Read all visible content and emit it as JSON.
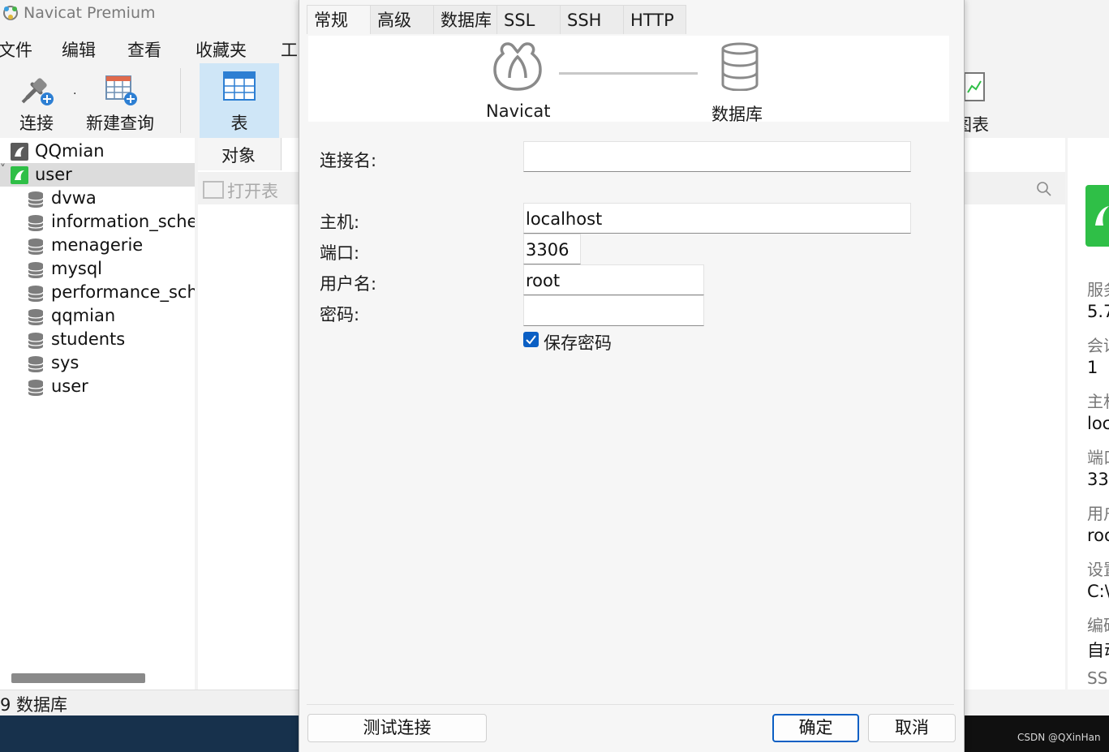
{
  "app": {
    "title": "Navicat Premium"
  },
  "menu": {
    "items": [
      "文件",
      "编辑",
      "查看",
      "收藏夹",
      "工"
    ]
  },
  "toolbar": {
    "connect_label": "连接",
    "new_query_label": "新建查询",
    "table_label": "表",
    "chart_label": "图表"
  },
  "tree": {
    "connections": [
      {
        "label": "QQmian"
      },
      {
        "label": "user"
      }
    ],
    "databases": [
      "dvwa",
      "information_sche",
      "menagerie",
      "mysql",
      "performance_sch",
      "qqmian",
      "students",
      "sys",
      "user"
    ]
  },
  "objects": {
    "tab_label": "对象",
    "open_table_label": "打开表"
  },
  "status": {
    "text": "9 数据库"
  },
  "right_panel": {
    "rows": [
      {
        "label": "服务",
        "value": "5.7"
      },
      {
        "label": "会话",
        "value": "1"
      },
      {
        "label": "主机",
        "value": "loc"
      },
      {
        "label": "端口",
        "value": "33"
      },
      {
        "label": "用户",
        "value": "roo"
      },
      {
        "label": "设置",
        "value": "C:\\"
      },
      {
        "label": "编码",
        "value": "自动"
      },
      {
        "label": "SSH",
        "value": ""
      }
    ]
  },
  "dialog": {
    "tabs": [
      "常规",
      "高级",
      "数据库",
      "SSL",
      "SSH",
      "HTTP"
    ],
    "diagram": {
      "left_label": "Navicat",
      "right_label": "数据库"
    },
    "fields": {
      "connection_name": {
        "label": "连接名:",
        "value": ""
      },
      "host": {
        "label": "主机:",
        "value": "localhost"
      },
      "port": {
        "label": "端口:",
        "value": "3306"
      },
      "username": {
        "label": "用户名:",
        "value": "root"
      },
      "password": {
        "label": "密码:",
        "value": ""
      }
    },
    "save_password": {
      "label": "保存密码",
      "checked": true
    },
    "buttons": {
      "test": "测试连接",
      "ok": "确定",
      "cancel": "取消"
    }
  },
  "watermark": "CSDN @QXinHan",
  "colors": {
    "accent": "#0b5fc4",
    "selected_tool": "#cfe6f7",
    "mysql_green": "#2fbf47"
  }
}
